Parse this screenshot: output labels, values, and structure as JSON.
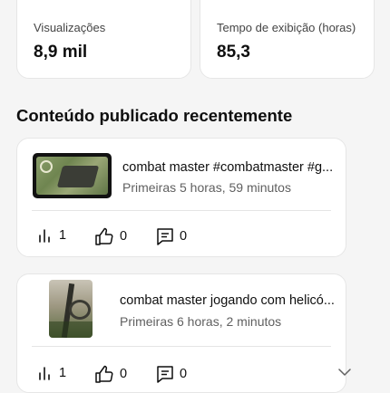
{
  "stats": [
    {
      "label": "Visualizações",
      "value": "8,9 mil"
    },
    {
      "label": "Tempo de exibição (horas)",
      "value": "85,3"
    }
  ],
  "section_title": "Conteúdo publicado recentemente",
  "videos": [
    {
      "title": "combat master #combatmaster #g...",
      "subtitle": "Primeiras 5 horas, 59 minutos",
      "views": "1",
      "likes": "0",
      "comments": "0"
    },
    {
      "title": "combat master jogando com helicó...",
      "subtitle": "Primeiras 6 horas, 2 minutos",
      "views": "1",
      "likes": "0",
      "comments": "0"
    }
  ],
  "icons": {
    "views": "bar-chart-icon",
    "likes": "thumbs-up-icon",
    "comments": "comment-icon",
    "expand": "chevron-down-icon"
  },
  "colors": {
    "background": "#f5f5f5",
    "card": "#ffffff",
    "secondary_text": "#606060"
  }
}
